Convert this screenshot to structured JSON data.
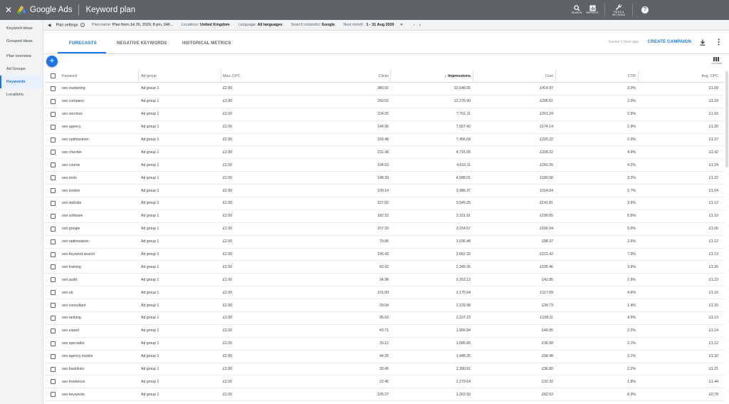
{
  "topbar": {
    "close": "✕",
    "brand": "Google Ads",
    "title": "Keyword plan",
    "icons": [
      {
        "name": "search-icon",
        "label": "SEARCH"
      },
      {
        "name": "reports-icon",
        "label": "REPORTS"
      },
      {
        "name": "tools-icon",
        "label": "TOOLS & SETTINGS"
      }
    ],
    "help": "?"
  },
  "sidebar": {
    "items": [
      {
        "label": "Keyword ideas",
        "active": false
      },
      {
        "label": "Grouped ideas",
        "active": false
      },
      {
        "label": "Plan overview",
        "active": false
      },
      {
        "label": "Ad Groups",
        "active": false
      },
      {
        "label": "Keywords",
        "active": true
      },
      {
        "label": "Locations",
        "active": false
      }
    ]
  },
  "settings": {
    "plan_settings": "Plan settings",
    "plan_name_label": "Plan name:",
    "plan_name": "Plan from Jul 26, 2020, 8 pm, GM...",
    "locations_label": "Locations:",
    "locations": "United Kingdom",
    "language_label": "Language:",
    "language": "All languages",
    "networks_label": "Search networks:",
    "networks": "Google",
    "period_label": "Next month",
    "period": "1 - 31 Aug 2020"
  },
  "tabs": [
    "FORECASTS",
    "NEGATIVE KEYWORDS",
    "HISTORICAL METRICS"
  ],
  "toolbar": {
    "saved": "Saved 1 hour ago",
    "create_campaign": "CREATE CAMPAIGN",
    "columns_label": "COLUMNS"
  },
  "table": {
    "headers": {
      "keyword": "Keyword",
      "ad_group": "Ad group",
      "max_cpc": "Max. CPC",
      "clicks": "Clicks",
      "impressions": "Impressions",
      "cost": "Cost",
      "ctr": "CTR",
      "avg_cpc": "Avg. CPC"
    },
    "rows": [
      [
        "seo marketing",
        "Ad group 1",
        "£2.00",
        "380.92",
        "12,548.05",
        "£414.97",
        "3.0%",
        "£1.09"
      ],
      [
        "seo company",
        "Ad group 1",
        "£2.00",
        "250.52",
        "12,276.90",
        "£295.51",
        "2.0%",
        "£1.18"
      ],
      [
        "seo services",
        "Ad group 1",
        "£2.00",
        "224.25",
        "7,701.11",
        "£261.24",
        "2.9%",
        "£1.16"
      ],
      [
        "seo agency",
        "Ad group 1",
        "£2.00",
        "144.95",
        "7,557.42",
        "£174.14",
        "1.9%",
        "£1.20"
      ],
      [
        "seo optimization",
        "Ad group 1",
        "£2.00",
        "169.48",
        "7,456.04",
        "£215.22",
        "2.3%",
        "£1.27"
      ],
      [
        "seo checker",
        "Ad group 1",
        "£2.00",
        "231.48",
        "4,715.05",
        "£328.22",
        "4.9%",
        "£1.42"
      ],
      [
        "seo course",
        "Ad group 1",
        "£2.00",
        "194.63",
        "4,616.11",
        "£242.26",
        "4.2%",
        "£1.24"
      ],
      [
        "seo tools",
        "Ad group 1",
        "£2.00",
        "148.39",
        "4,588.01",
        "£180.58",
        "3.2%",
        "£1.22"
      ],
      [
        "seo london",
        "Ad group 1",
        "£2.00",
        "109.14",
        "3,986.37",
        "£114.04",
        "2.7%",
        "£1.04"
      ],
      [
        "seo website",
        "Ad group 1",
        "£2.00",
        "127.02",
        "3,545.25",
        "£141.81",
        "3.6%",
        "£1.12"
      ],
      [
        "seo software",
        "Ad group 1",
        "£2.00",
        "182.32",
        "3,331.91",
        "£199.65",
        "5.5%",
        "£1.10"
      ],
      [
        "seo google",
        "Ad group 1",
        "£2.00",
        "157.33",
        "3,154.57",
        "£166.04",
        "5.0%",
        "£1.06"
      ],
      [
        "seo optimisation",
        "Ad group 1",
        "£2.00",
        "79.06",
        "3,036.48",
        "£88.37",
        "2.6%",
        "£1.12"
      ],
      [
        "seo keyword search",
        "Ad group 1",
        "£2.00",
        "195.43",
        "2,662.32",
        "£221.42",
        "7.3%",
        "£1.13"
      ],
      [
        "seo training",
        "Ad group 1",
        "£2.00",
        "83.92",
        "2,349.35",
        "£105.46",
        "3.6%",
        "£1.26"
      ],
      [
        "seo audit",
        "Ad group 1",
        "£2.00",
        "34.98",
        "2,253.13",
        "£42.85",
        "1.6%",
        "£1.23"
      ],
      [
        "seo uk",
        "Ad group 1",
        "£2.00",
        "101.00",
        "2,175.64",
        "£117.09",
        "4.6%",
        "£1.16"
      ],
      [
        "seo consultant",
        "Ad group 1",
        "£2.00",
        "29.04",
        "2,129.98",
        "£34.73",
        "1.4%",
        "£1.20"
      ],
      [
        "seo ranking",
        "Ad group 1",
        "£2.00",
        "95.63",
        "2,107.23",
        "£108.11",
        "4.5%",
        "£1.13"
      ],
      [
        "seo expert",
        "Ad group 1",
        "£2.00",
        "43.71",
        "1,966.84",
        "£49.95",
        "2.2%",
        "£1.14"
      ],
      [
        "seo specialist",
        "Ad group 1",
        "£2.00",
        "33.12",
        "1,585.89",
        "£36.98",
        "2.1%",
        "£1.12"
      ],
      [
        "seo agency london",
        "Ad group 1",
        "£2.00",
        "44.26",
        "1,448.35",
        "£58.48",
        "3.1%",
        "£1.32"
      ],
      [
        "seo backlinks",
        "Ad group 1",
        "£2.00",
        "30.45",
        "1,390.91",
        "£36.80",
        "2.2%",
        "£1.21"
      ],
      [
        "seo freelancer",
        "Ad group 1",
        "£2.00",
        "22.45",
        "1,279.64",
        "£32.32",
        "1.8%",
        "£1.44"
      ],
      [
        "seo keywords",
        "Ad group 1",
        "£2.00",
        "105.27",
        "1,263.93",
        "£82.53",
        "8.3%",
        "£0.78"
      ]
    ]
  },
  "colors": {
    "topbar": "#5f6368",
    "accent": "#1a73e8",
    "sidebar_bg": "#f1f3f4"
  }
}
